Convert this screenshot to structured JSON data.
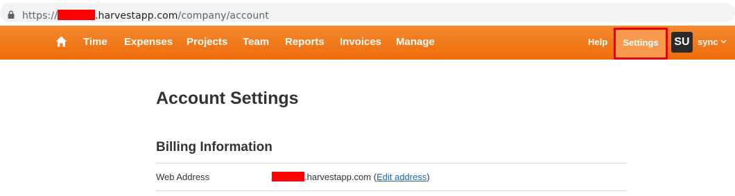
{
  "browser": {
    "url_scheme": "https://",
    "url_domain_suffix": ".harvestapp.com",
    "url_path": "/company/account",
    "icon": "lock-icon"
  },
  "nav": {
    "home_icon": "home-icon",
    "items": [
      "Time",
      "Expenses",
      "Projects",
      "Team",
      "Reports",
      "Invoices",
      "Manage"
    ],
    "help": "Help",
    "settings": "Settings",
    "avatar_initials": "SU",
    "user_menu": "sync",
    "accent_color": "#f07a1e",
    "highlight_color": "#e8000f"
  },
  "page": {
    "title": "Account Settings",
    "section_title": "Billing Information",
    "fields": [
      {
        "label": "Web Address",
        "value_suffix": ".harvestapp.com",
        "link_open": "(",
        "link_text": "Edit address",
        "link_close": ")"
      }
    ]
  }
}
